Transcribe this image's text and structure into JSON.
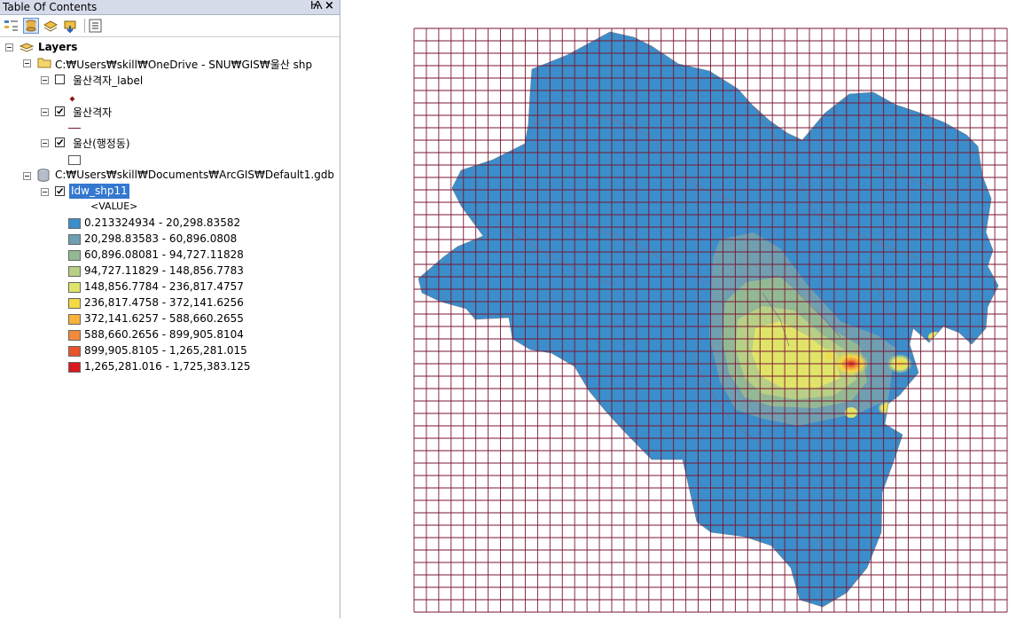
{
  "toc": {
    "title": "Table Of Contents",
    "pin_icon": "Ѩ",
    "close_icon": "×"
  },
  "tree": {
    "root_label": "Layers",
    "folder1_path": "C:₩Users₩skill₩OneDrive - SNU₩GIS₩울산 shp",
    "layer_label_name": "울산격자_label",
    "layer_label_checked": false,
    "layer_grid_name": "울산격자",
    "layer_grid_checked": true,
    "layer_admin_name": "울산(행정동)",
    "layer_admin_checked": true,
    "gdb_path": "C:₩Users₩skill₩Documents₩ArcGIS₩Default1.gdb",
    "layer_idw_name": "Idw_shp11",
    "layer_idw_checked": true,
    "value_header": "<VALUE>"
  },
  "legend": [
    {
      "label": "0.213324934 - 20,298.83582",
      "color": "#3b8ecb"
    },
    {
      "label": "20,298.83583 - 60,896.0808",
      "color": "#6f9fb1"
    },
    {
      "label": "60,896.08081 - 94,727.11828",
      "color": "#93b994"
    },
    {
      "label": "94,727.11829 - 148,856.7783",
      "color": "#b8cf86"
    },
    {
      "label": "148,856.7784 - 236,817.4757",
      "color": "#e0e56a"
    },
    {
      "label": "236,817.4758 - 372,141.6256",
      "color": "#f5d943"
    },
    {
      "label": "372,141.6257 - 588,660.2655",
      "color": "#f7b23a"
    },
    {
      "label": "588,660.2656 - 899,905.8104",
      "color": "#f28a3b"
    },
    {
      "label": "899,905.8105 - 1,265,281.015",
      "color": "#e8552d"
    },
    {
      "label": "1,265,281.016 - 1,725,383.125",
      "color": "#d9181d"
    }
  ],
  "colors": {
    "grid_line": "#7a1530",
    "region_fill": "#3b8ecb",
    "boundary": "#7b6e8c"
  }
}
